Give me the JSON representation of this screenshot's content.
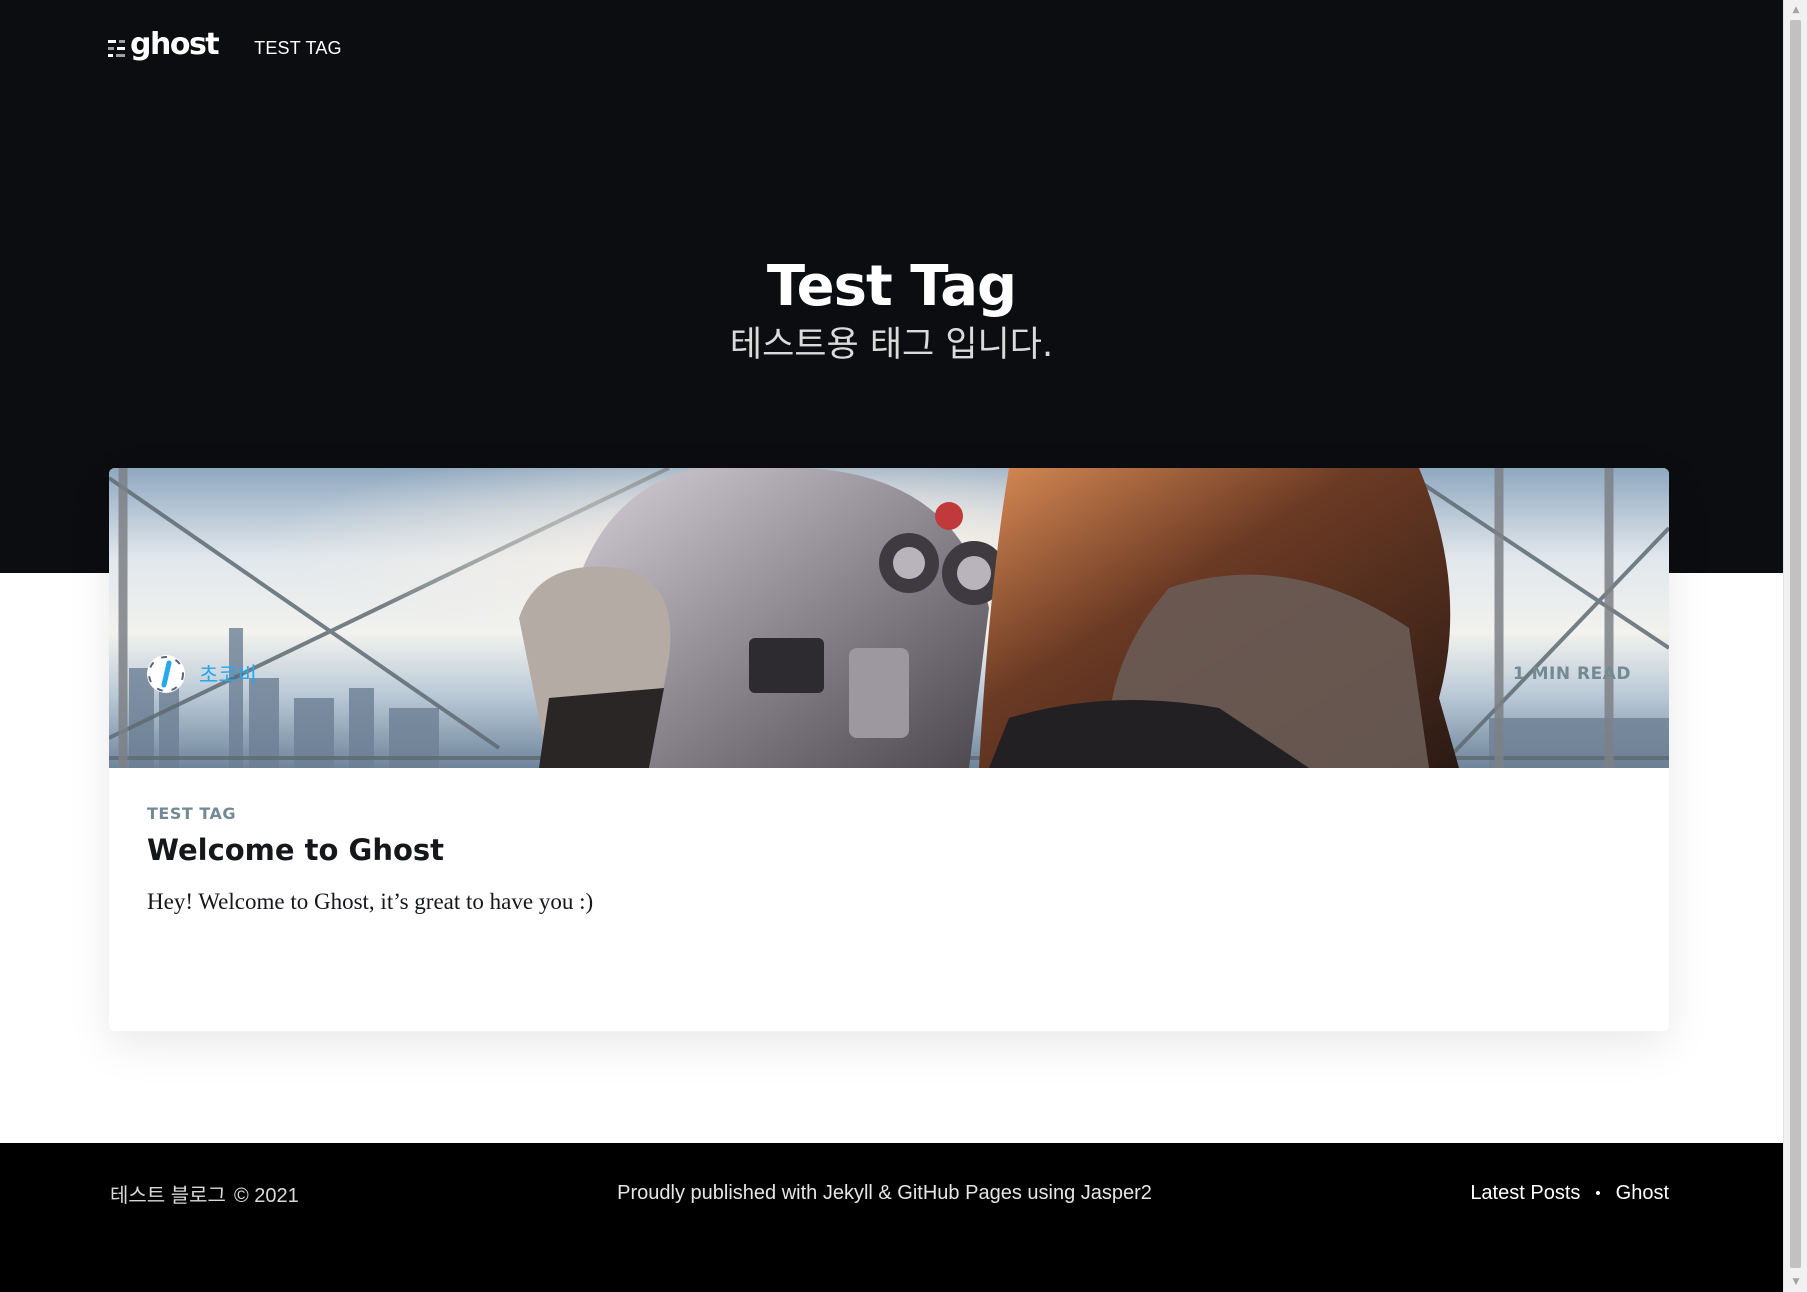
{
  "site": {
    "logo_text": "ghost",
    "nav": [
      {
        "label": "TEST TAG"
      }
    ]
  },
  "header": {
    "title": "Test Tag",
    "description": "테스트용 태그 입니다."
  },
  "post_card": {
    "tag": "TEST TAG",
    "title": "Welcome to Ghost",
    "excerpt": "Hey! Welcome to Ghost, it’s great to have you :)",
    "author": "초코비",
    "reading_time": "1 MIN READ",
    "image_description_icon": "binoculars-photo"
  },
  "footer": {
    "copyright_name": "테스트 블로그",
    "copyright_year": "© 2021",
    "credit": "Proudly published with Jekyll & GitHub Pages using Jasper2",
    "links": [
      {
        "label": "Latest Posts"
      },
      {
        "label": "Ghost"
      }
    ],
    "separator": "•"
  },
  "colors": {
    "hero_bg": "#0b0d10",
    "footer_bg": "#000000",
    "accent_blue": "#26a8ed",
    "meta_gray": "#738a94"
  }
}
